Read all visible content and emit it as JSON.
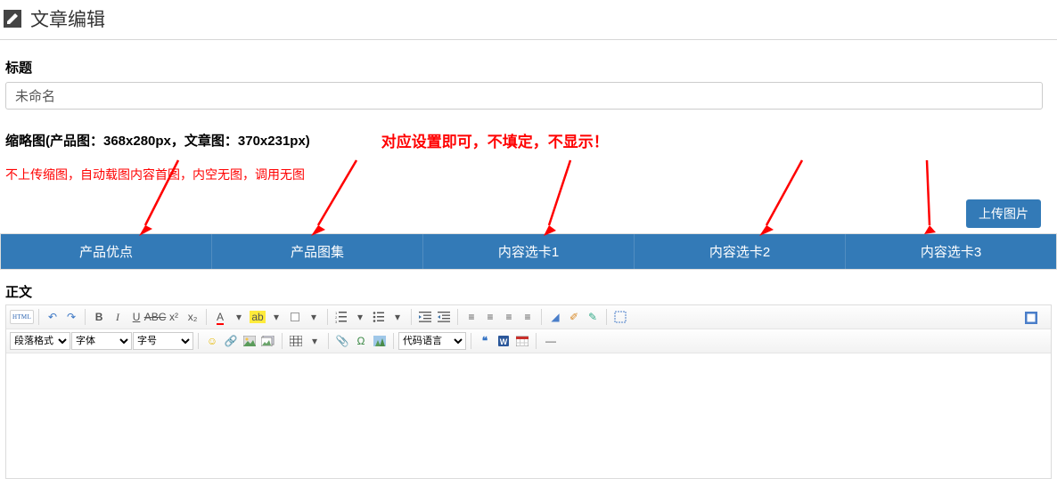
{
  "header": {
    "title": "文章编辑"
  },
  "title_field": {
    "label": "标题",
    "value": "未命名"
  },
  "thumbnail": {
    "label": "缩略图(产品图：368x280px，文章图：370x231px)",
    "overlay_note": "对应设置即可，不填定，不显示！",
    "sub_note": "不上传缩图，自动载图内容首图，内空无图，调用无图",
    "upload_btn": "上传图片"
  },
  "tabs": [
    {
      "label": "产品优点"
    },
    {
      "label": "产品图集"
    },
    {
      "label": "内容选卡1"
    },
    {
      "label": "内容选卡2"
    },
    {
      "label": "内容选卡3"
    }
  ],
  "body_label": "正文",
  "editor": {
    "html_btn": "HTML",
    "row2": {
      "format_sel": "段落格式",
      "font_sel": "字体",
      "size_sel": "字号",
      "code_sel": "代码语言"
    }
  }
}
